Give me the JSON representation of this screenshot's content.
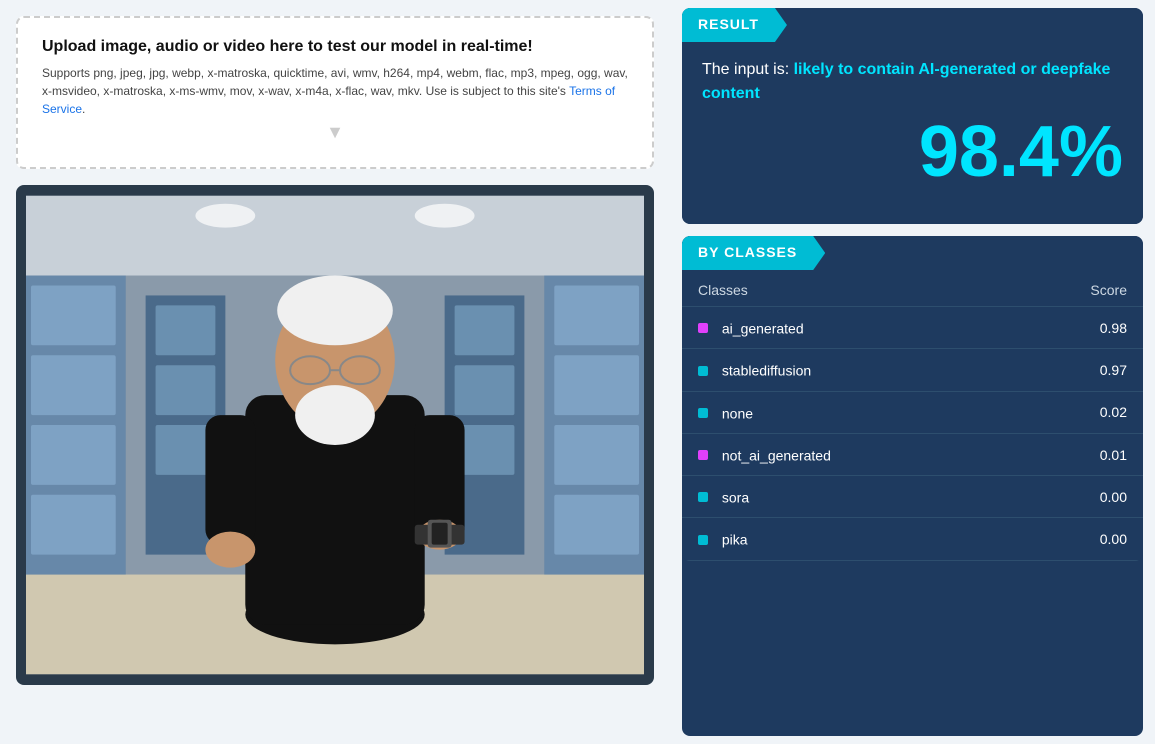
{
  "upload": {
    "title": "Upload image, audio or video here to test our model in real-time!",
    "description": "Supports png, jpeg, jpg, webp, x-matroska, quicktime, avi, wmv, h264, mp4, webm, flac, mp3, mpeg, ogg, wav, x-msvideo, x-matroska, x-ms-wmv, mov, x-wav, x-m4a, x-flac, wav, mkv. Use is subject to this site's",
    "terms_link": "Terms of Service",
    "terms_link_suffix": "."
  },
  "result": {
    "header": "RESULT",
    "description_prefix": "The input is: ",
    "description_highlight": "likely to contain AI-generated or deepfake content",
    "percentage": "98.4%"
  },
  "by_classes": {
    "header": "BY CLASSES",
    "col_classes": "Classes",
    "col_score": "Score",
    "rows": [
      {
        "name": "ai_generated",
        "score": "0.98",
        "color": "#e040fb"
      },
      {
        "name": "stablediffusion",
        "score": "0.97",
        "color": "#00bcd4"
      },
      {
        "name": "none",
        "score": "0.02",
        "color": "#00bcd4"
      },
      {
        "name": "not_ai_generated",
        "score": "0.01",
        "color": "#e040fb"
      },
      {
        "name": "sora",
        "score": "0.00",
        "color": "#00bcd4"
      },
      {
        "name": "pika",
        "score": "0.00",
        "color": "#00bcd4"
      }
    ]
  }
}
